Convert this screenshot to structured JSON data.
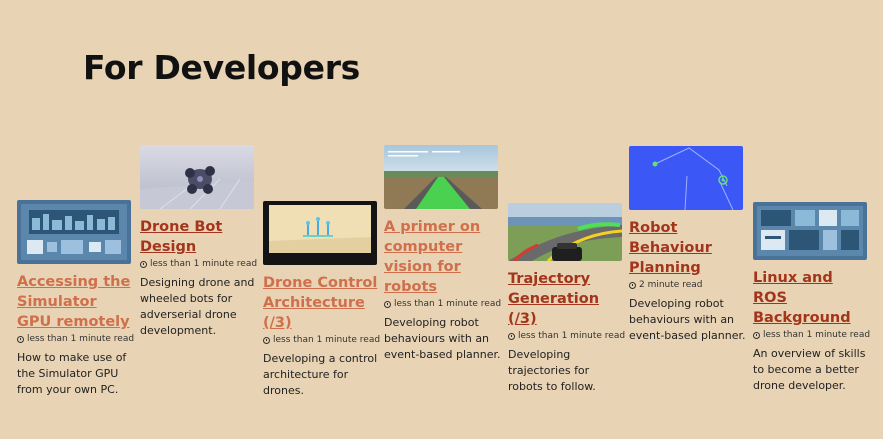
{
  "heading": "For Developers",
  "colors": {
    "background": "#e8d3b4",
    "link_dark": "#a3351d",
    "link_light": "#cf6f4c"
  },
  "cards": [
    {
      "title": "Accessing the Simulator GPU remotely",
      "time": "less than 1 minute read",
      "description": "How to make use of the Simulator GPU from your own PC."
    },
    {
      "title": "Drone Bot Design",
      "time": "less than 1 minute read",
      "description": "Designing drone and wheeled bots for adverserial drone development."
    },
    {
      "title": "Drone Control Architecture (/3)",
      "time": "less than 1 minute read",
      "description": "Developing a control architecture for drones."
    },
    {
      "title": "A primer on computer vision for robots",
      "time": "less than 1 minute read",
      "description": "Developing robot behaviours with an event-based planner."
    },
    {
      "title": "Trajectory Generation (/3)",
      "time": "less than 1 minute read",
      "description": "Developing trajectories for robots to follow."
    },
    {
      "title": "Robot Behaviour Planning",
      "time": "2 minute read",
      "description": "Developing robot behaviours with an event-based planner."
    },
    {
      "title": "Linux and ROS Background",
      "time": "less than 1 minute read",
      "description": "An overview of skills to become a better drone developer."
    }
  ]
}
